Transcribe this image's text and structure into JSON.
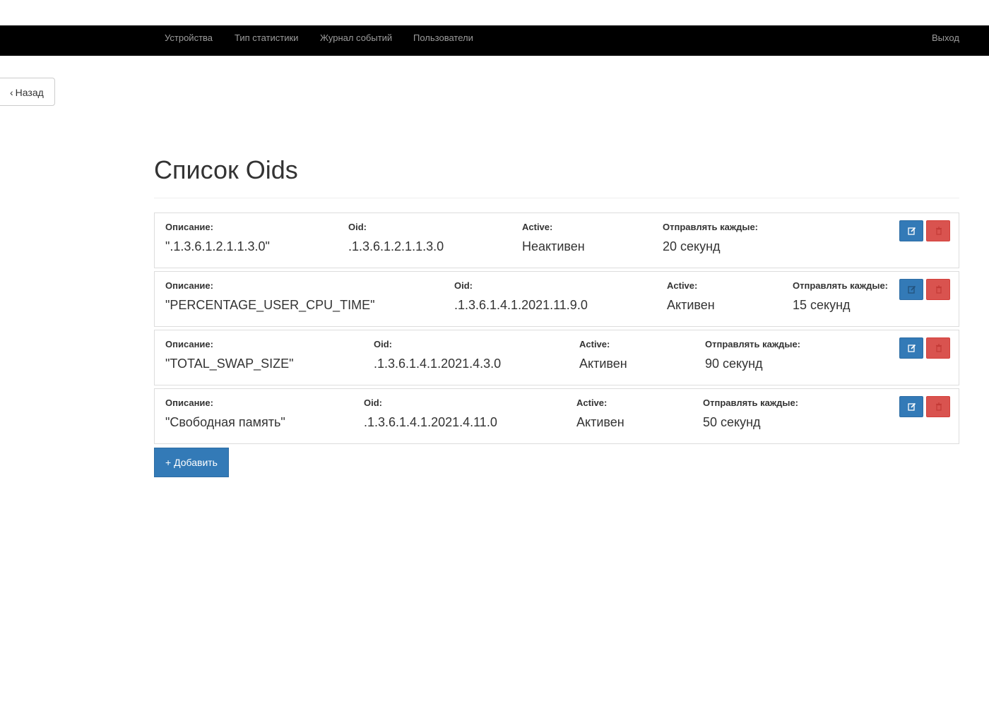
{
  "nav": {
    "items": [
      {
        "label": "Устройства"
      },
      {
        "label": "Тип статистики"
      },
      {
        "label": "Журнал событий"
      },
      {
        "label": "Пользователи"
      }
    ],
    "logout_label": "Выход"
  },
  "back_label": "Назад",
  "page_title": "Список Oids",
  "labels": {
    "description": "Описание:",
    "oid": "Oid:",
    "active": "Active:",
    "send_every": "Отправлять каждые:"
  },
  "rows": [
    {
      "description": "\".1.3.6.1.2.1.1.3.0\"",
      "oid": ".1.3.6.1.2.1.1.3.0",
      "active": "Неактивен",
      "send_every": "20 секунд"
    },
    {
      "description": "\"PERCENTAGE_USER_CPU_TIME\"",
      "oid": ".1.3.6.1.4.1.2021.11.9.0",
      "active": "Активен",
      "send_every": "15 секунд"
    },
    {
      "description": "\"TOTAL_SWAP_SIZE\"",
      "oid": ".1.3.6.1.4.1.2021.4.3.0",
      "active": "Активен",
      "send_every": "90 секунд"
    },
    {
      "description": "\"Свободная память\"",
      "oid": ".1.3.6.1.4.1.2021.4.11.0",
      "active": "Активен",
      "send_every": "50 секунд"
    }
  ],
  "add_label": "+ Добавить",
  "icons": {
    "edit": "edit-icon",
    "delete": "trash-icon",
    "back": "chevron-left-icon"
  },
  "colors": {
    "primary": "#337ab7",
    "danger": "#d9534f",
    "navbar": "#000000"
  }
}
